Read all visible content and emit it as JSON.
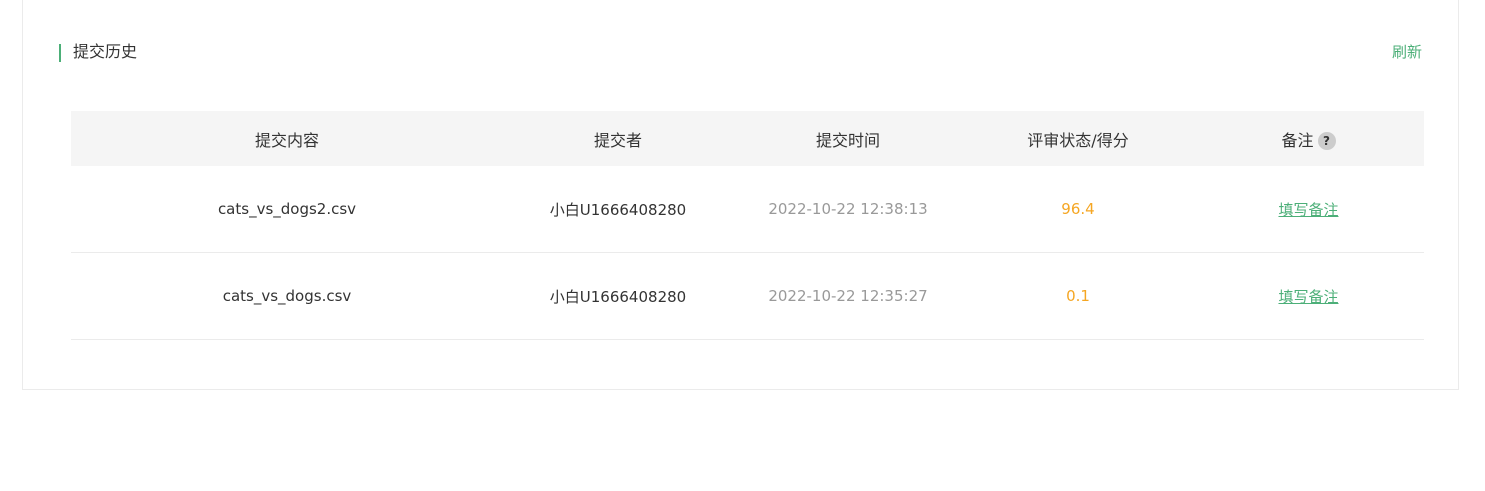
{
  "section": {
    "title": "提交历史",
    "refresh_label": "刷新"
  },
  "table": {
    "headers": {
      "content": "提交内容",
      "submitter": "提交者",
      "time": "提交时间",
      "status": "评审状态/得分",
      "note": "备注",
      "help_icon": "?"
    },
    "rows": [
      {
        "content": "cats_vs_dogs2.csv",
        "submitter": "小白U1666408280",
        "time": "2022-10-22 12:38:13",
        "score": "96.4",
        "note_action": "填写备注"
      },
      {
        "content": "cats_vs_dogs.csv",
        "submitter": "小白U1666408280",
        "time": "2022-10-22 12:35:27",
        "score": "0.1",
        "note_action": "填写备注"
      }
    ]
  },
  "colors": {
    "accent": "#4caf78",
    "score": "#f5a623",
    "muted": "#999999"
  }
}
